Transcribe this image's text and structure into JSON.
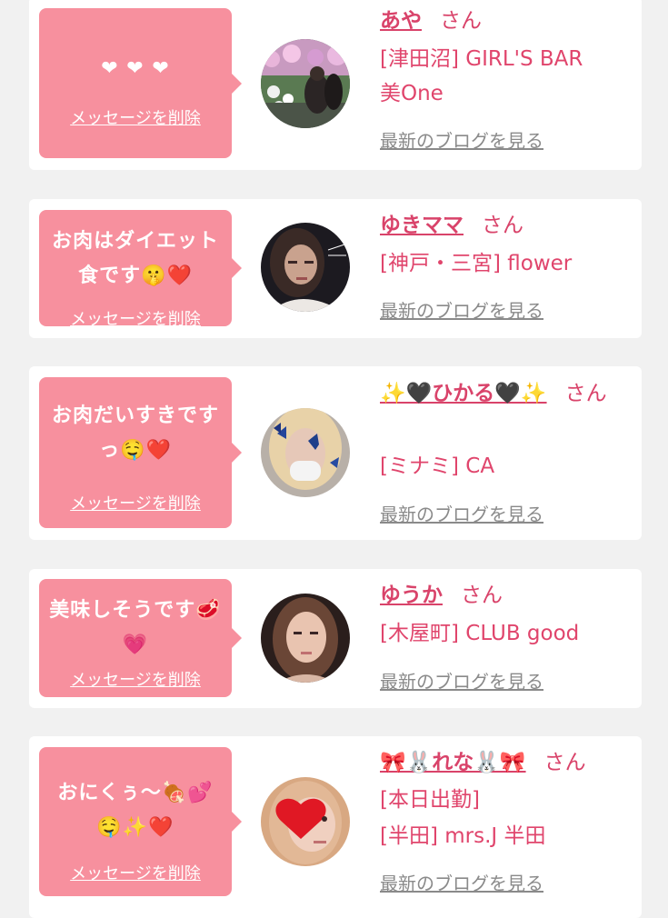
{
  "delete_label": "メッセージを削除",
  "blog_label": "最新のブログを見る",
  "san_suffix": "さん",
  "colors": {
    "background": "#f1f1f1",
    "card": "#ffffff",
    "bubble": "#f7909e",
    "name": "#d9436a",
    "link_gray": "#8a8a8a"
  },
  "entries": [
    {
      "message_lines": [
        "❤ ❤ ❤"
      ],
      "name": "あや",
      "shop_lines": [
        "[津田沼] GIRL'S BAR",
        "美One"
      ],
      "avatar_icon": "woman-in-flower-garden-photo"
    },
    {
      "message_lines": [
        "お肉はダイエット",
        "食です🤫❤️"
      ],
      "name": "ゆきママ",
      "shop_lines": [
        "[神戸・三宮] flower"
      ],
      "avatar_icon": "woman-night-selfie-photo"
    },
    {
      "message_lines": [
        "お肉だいすきです",
        "っ🤤❤️"
      ],
      "name": "✨🖤ひかる🖤✨",
      "shop_lines": [
        "[ミナミ] CA"
      ],
      "avatar_icon": "blonde-woman-with-butterflies-photo"
    },
    {
      "message_lines": [
        "美味しそうです🥩",
        "💗"
      ],
      "name": "ゆうか",
      "shop_lines": [
        "[木屋町] CLUB good"
      ],
      "avatar_icon": "woman-portrait-photo"
    },
    {
      "message_lines": [
        "おにくぅ〜🍖💕",
        "🤤✨❤️"
      ],
      "name": "🎀🐰れな🐰🎀",
      "shop_lines": [
        "[本日出勤]",
        "[半田] mrs.J 半田"
      ],
      "avatar_icon": "woman-with-heart-sticker-photo"
    }
  ]
}
